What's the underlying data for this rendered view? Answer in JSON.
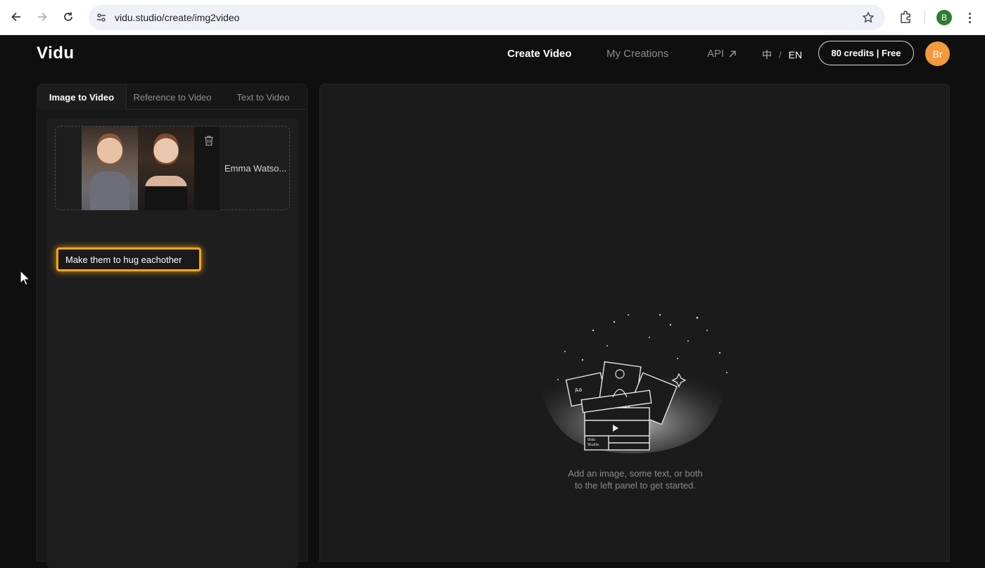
{
  "browser": {
    "url": "vidu.studio/create/img2video",
    "profile_initial": "B"
  },
  "header": {
    "logo": "Vidu",
    "nav": [
      "Create Video",
      "My Creations",
      "API"
    ],
    "lang_zh": "中",
    "lang_sep": "/",
    "lang_en": "EN",
    "credits": "80 credits | Free",
    "avatar": "Br"
  },
  "tabs": [
    "Image to Video",
    "Reference to Video",
    "Text to Video"
  ],
  "upload": {
    "image_name": "Emma Watso..."
  },
  "prompt": {
    "value": "Make them to hug eachother"
  },
  "empty_state": {
    "line1": "Add an image, some text, or both",
    "line2": "to the left panel to get started.",
    "illustration_label_a": "Aa",
    "illustration_label_b": "Vidu",
    "illustration_label_c": "Studio"
  },
  "colors": {
    "accent_highlight": "#f7a51a",
    "avatar_bg": "#f29a3c",
    "background": "#0f0f0f"
  },
  "icons": [
    "back-arrow-icon",
    "forward-arrow-icon",
    "reload-icon",
    "site-settings-icon",
    "star-icon",
    "extensions-icon",
    "kebab-menu-icon",
    "external-arrow-icon",
    "trash-icon",
    "cursor-icon"
  ]
}
